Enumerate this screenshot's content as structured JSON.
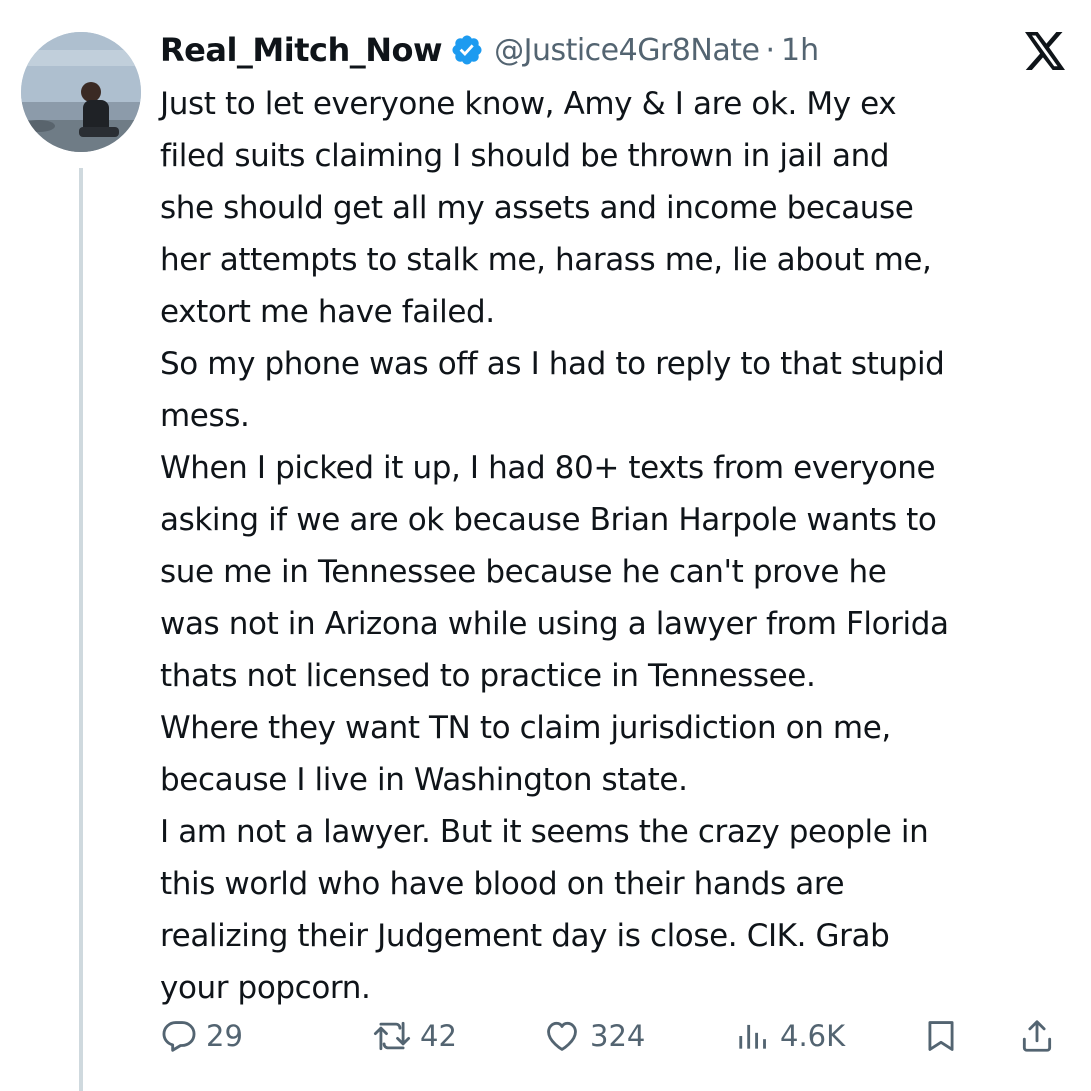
{
  "author": {
    "display_name": "Real_Mitch_Now",
    "handle": "@Justice4Gr8Nate",
    "separator": "·",
    "time": "1h",
    "verified": true
  },
  "tweet": {
    "lines": [
      "Just to let everyone know, Amy & I are ok. My ex",
      "filed suits claiming I should be thrown in jail and",
      "she should get all my assets and income because",
      "her attempts to stalk me, harass me, lie about me,",
      "extort me have failed.",
      "So my phone was off as I had to reply to that stupid",
      "mess.",
      "When I picked it up, I had 80+ texts from everyone",
      "asking if we are ok because Brian Harpole wants to",
      "sue me in Tennessee because he can't prove he",
      "was not in Arizona while using a lawyer from Florida",
      "thats not licensed to practice in Tennessee.",
      "Where they want TN to claim jurisdiction on me,",
      "because I live in Washington state.",
      "I am not a lawyer. But it seems the crazy people in",
      "this world who have blood on their hands are",
      "realizing their Judgement day is close. CIK. Grab",
      "your popcorn."
    ]
  },
  "metrics": {
    "replies": "29",
    "reposts": "42",
    "likes": "324",
    "views": "4.6K"
  },
  "icons": {
    "verified": "verified-badge-icon",
    "platform": "x-logo-icon",
    "reply": "reply-icon",
    "repost": "repost-icon",
    "like": "like-icon",
    "views": "views-icon",
    "bookmark": "bookmark-icon",
    "share": "share-icon"
  },
  "colors": {
    "text": "#0f1419",
    "secondary": "#536471",
    "verified_blue": "#1d9bf0",
    "thread_line": "#cfd9de"
  }
}
